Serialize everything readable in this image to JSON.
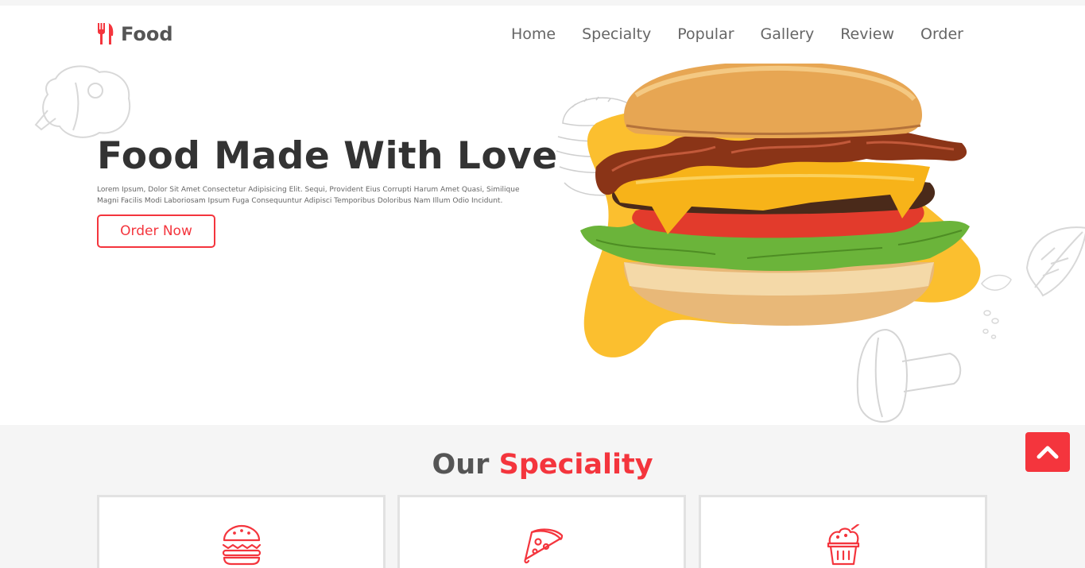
{
  "brand": {
    "name": "Food",
    "logo_icon": "fork-knife-icon",
    "accent_color": "#f4353d"
  },
  "nav": {
    "items": [
      {
        "label": "Home"
      },
      {
        "label": "Specialty"
      },
      {
        "label": "Popular"
      },
      {
        "label": "Gallery"
      },
      {
        "label": "Review"
      },
      {
        "label": "Order"
      }
    ]
  },
  "hero": {
    "title": "Food Made With Love",
    "description": "Lorem Ipsum, Dolor Sit Amet Consectetur Adipisicing Elit. Sequi, Provident Eius Corrupti Harum Amet Quasi, Similique Magni Facilis Modi Laboriosam Ipsum Fuga Consequuntur Adipisci Temporibus Doloribus Nam Illum Odio Incidunt.",
    "cta_label": "Order Now",
    "blob_color": "#fbbf2f"
  },
  "speciality": {
    "title_plain": "Our",
    "title_accent": "Speciality",
    "cards": [
      {
        "icon": "burger-icon"
      },
      {
        "icon": "pizza-icon"
      },
      {
        "icon": "ice-cream-icon"
      }
    ]
  },
  "scroll_top": {
    "icon": "chevron-up-icon"
  }
}
